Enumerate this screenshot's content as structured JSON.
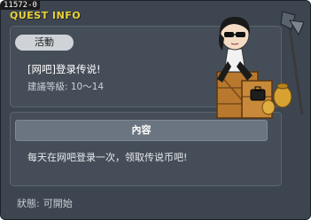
{
  "window": {
    "code": "11572-0",
    "title": "QUEST INFO"
  },
  "quest": {
    "category": "活動",
    "name": "[网吧]登录传说!",
    "level_requirement": "建議等級: 10～14"
  },
  "content": {
    "header": "內容",
    "text": "每天在网吧登录一次，领取传说币吧!"
  },
  "status": {
    "label": "狀態:",
    "value": "可開始"
  },
  "npc": {
    "icon": "npc-portrait-icon"
  },
  "colors": {
    "window_bg": "#3d4650",
    "panel_bg": "#454e58",
    "title_yellow": "#e8d23a",
    "pill_bg": "#cfd3d8",
    "header_bg": "#6b7581"
  }
}
